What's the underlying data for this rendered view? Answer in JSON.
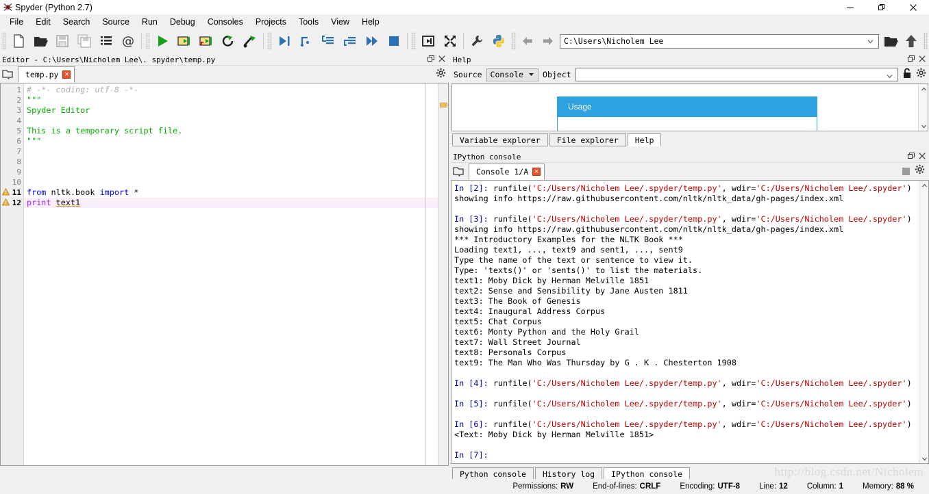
{
  "window": {
    "title": "Spyder (Python 2.7)",
    "logo_icon": "spyder-logo-icon",
    "minimize_label": "—",
    "restore_label": "❐",
    "close_label": "✕"
  },
  "menubar": {
    "items": [
      {
        "label": "File"
      },
      {
        "label": "Edit"
      },
      {
        "label": "Search"
      },
      {
        "label": "Source"
      },
      {
        "label": "Run"
      },
      {
        "label": "Debug"
      },
      {
        "label": "Consoles"
      },
      {
        "label": "Projects"
      },
      {
        "label": "Tools"
      },
      {
        "label": "View"
      },
      {
        "label": "Help"
      }
    ]
  },
  "toolbar": {
    "buttons": [
      {
        "name": "new-file-icon"
      },
      {
        "name": "open-file-icon"
      },
      {
        "name": "save-file-icon"
      },
      {
        "name": "save-all-icon"
      },
      {
        "name": "list-icon"
      },
      {
        "name": "at-sign-icon"
      },
      {
        "name": "run-icon"
      },
      {
        "name": "run-cell-icon"
      },
      {
        "name": "run-cell-advance-icon"
      },
      {
        "name": "rerun-icon"
      },
      {
        "name": "run-selection-icon"
      },
      {
        "name": "debug-icon"
      },
      {
        "name": "step-over-icon"
      },
      {
        "name": "step-into-icon"
      },
      {
        "name": "step-return-icon"
      },
      {
        "name": "continue-icon"
      },
      {
        "name": "stop-debug-icon"
      },
      {
        "name": "maximize-pane-icon"
      },
      {
        "name": "fullscreen-icon"
      },
      {
        "name": "preferences-icon"
      },
      {
        "name": "python-path-manager-icon"
      }
    ],
    "back_icon": "back-arrow-icon",
    "forward_icon": "forward-arrow-icon",
    "path_value": "C:\\Users\\Nicholem Lee",
    "browse_icon": "open-folder-icon",
    "parent_dir_icon": "up-arrow-icon"
  },
  "editor": {
    "panel_title": "Editor - C:\\Users\\Nicholem Lee\\. spyder\\temp.py",
    "undock_icon": "undock-icon",
    "close_icon": "close-icon",
    "browse_tabs_icon": "browse-tabs-icon",
    "options_icon": "gear-icon",
    "tab": {
      "label": "temp.py",
      "close_label": "×"
    },
    "lines": [
      {
        "n": "1",
        "warn": false,
        "tokens": [
          {
            "t": "# -*- coding: utf-8 -*-",
            "c": "c-com"
          }
        ]
      },
      {
        "n": "2",
        "warn": false,
        "tokens": [
          {
            "t": "\"\"\"",
            "c": "c-str"
          }
        ]
      },
      {
        "n": "3",
        "warn": false,
        "tokens": [
          {
            "t": "Spyder Editor",
            "c": "c-str"
          }
        ]
      },
      {
        "n": "4",
        "warn": false,
        "tokens": [
          {
            "t": "",
            "c": "c-str"
          }
        ]
      },
      {
        "n": "5",
        "warn": false,
        "tokens": [
          {
            "t": "This is a temporary script file.",
            "c": "c-str"
          }
        ]
      },
      {
        "n": "6",
        "warn": false,
        "tokens": [
          {
            "t": "\"\"\"",
            "c": "c-str"
          }
        ]
      },
      {
        "n": "7",
        "warn": false,
        "tokens": [
          {
            "t": "",
            "c": ""
          }
        ]
      },
      {
        "n": "8",
        "warn": false,
        "tokens": [
          {
            "t": "",
            "c": ""
          }
        ]
      },
      {
        "n": "9",
        "warn": false,
        "tokens": [
          {
            "t": "",
            "c": ""
          }
        ]
      },
      {
        "n": "10",
        "warn": false,
        "tokens": [
          {
            "t": "",
            "c": ""
          }
        ]
      },
      {
        "n": "11",
        "warn": true,
        "tokens": [
          {
            "t": "from",
            "c": "c-kw"
          },
          {
            "t": " nltk.book ",
            "c": ""
          },
          {
            "t": "import",
            "c": "c-kw"
          },
          {
            "t": " *",
            "c": ""
          }
        ]
      },
      {
        "n": "12",
        "warn": true,
        "current": true,
        "tokens": [
          {
            "t": "print",
            "c": "c-kw2"
          },
          {
            "t": " ",
            "c": ""
          },
          {
            "t": "text1",
            "c": "c-var"
          }
        ]
      }
    ],
    "warning_icon": "warning-triangle-icon",
    "scroll_marker": "warning-scroll-marker"
  },
  "help": {
    "panel_title": "Help",
    "undock_icon": "undock-icon",
    "close_icon": "close-icon",
    "source_label": "Source",
    "source_value": "Console",
    "object_label": "Object",
    "object_value": "",
    "object_placeholder": "",
    "lock_icon": "lock-icon",
    "options_icon": "gear-icon",
    "usage_card_title": "Usage",
    "usage_accent_color": "#2ea1e0",
    "scroll_up_icon": "chevron-up-icon",
    "scroll_down_icon": "chevron-down-icon",
    "tabs": [
      {
        "label": "Variable explorer",
        "active": false
      },
      {
        "label": "File explorer",
        "active": false
      },
      {
        "label": "Help",
        "active": true
      }
    ]
  },
  "console": {
    "panel_title": "IPython console",
    "undock_icon": "undock-icon",
    "close_icon": "close-icon",
    "browse_tabs_icon": "browse-tabs-icon",
    "stop_icon": "stop-icon",
    "options_icon": "gear-icon",
    "tab": {
      "label": "Console 1/A",
      "close_label": "×"
    },
    "scroll_up_icon": "chevron-up-icon",
    "scroll_down_icon": "chevron-down-icon",
    "output": [
      {
        "tokens": [
          {
            "t": "In [2]: ",
            "c": "o-in"
          },
          {
            "t": "runfile(",
            "c": ""
          },
          {
            "t": "'C:/Users/Nicholem Lee/.spyder/temp.py'",
            "c": "o-str"
          },
          {
            "t": ", wdir=",
            "c": ""
          },
          {
            "t": "'C:/Users/Nicholem Lee/.spyder'",
            "c": "o-str"
          },
          {
            "t": ")",
            "c": ""
          }
        ]
      },
      {
        "tokens": [
          {
            "t": "showing info https://raw.githubusercontent.com/nltk/nltk_data/gh-pages/index.xml",
            "c": ""
          }
        ]
      },
      {
        "tokens": [
          {
            "t": "",
            "c": ""
          }
        ]
      },
      {
        "tokens": [
          {
            "t": "In [3]: ",
            "c": "o-in"
          },
          {
            "t": "runfile(",
            "c": ""
          },
          {
            "t": "'C:/Users/Nicholem Lee/.spyder/temp.py'",
            "c": "o-str"
          },
          {
            "t": ", wdir=",
            "c": ""
          },
          {
            "t": "'C:/Users/Nicholem Lee/.spyder'",
            "c": "o-str"
          },
          {
            "t": ")",
            "c": ""
          }
        ]
      },
      {
        "tokens": [
          {
            "t": "showing info https://raw.githubusercontent.com/nltk/nltk_data/gh-pages/index.xml",
            "c": ""
          }
        ]
      },
      {
        "tokens": [
          {
            "t": "*** Introductory Examples for the NLTK Book ***",
            "c": ""
          }
        ]
      },
      {
        "tokens": [
          {
            "t": "Loading text1, ..., text9 and sent1, ..., sent9",
            "c": ""
          }
        ]
      },
      {
        "tokens": [
          {
            "t": "Type the name of the text or sentence to view it.",
            "c": ""
          }
        ]
      },
      {
        "tokens": [
          {
            "t": "Type: 'texts()' or 'sents()' to list the materials.",
            "c": ""
          }
        ]
      },
      {
        "tokens": [
          {
            "t": "text1: Moby Dick by Herman Melville 1851",
            "c": ""
          }
        ]
      },
      {
        "tokens": [
          {
            "t": "text2: Sense and Sensibility by Jane Austen 1811",
            "c": ""
          }
        ]
      },
      {
        "tokens": [
          {
            "t": "text3: The Book of Genesis",
            "c": ""
          }
        ]
      },
      {
        "tokens": [
          {
            "t": "text4: Inaugural Address Corpus",
            "c": ""
          }
        ]
      },
      {
        "tokens": [
          {
            "t": "text5: Chat Corpus",
            "c": ""
          }
        ]
      },
      {
        "tokens": [
          {
            "t": "text6: Monty Python and the Holy Grail",
            "c": ""
          }
        ]
      },
      {
        "tokens": [
          {
            "t": "text7: Wall Street Journal",
            "c": ""
          }
        ]
      },
      {
        "tokens": [
          {
            "t": "text8: Personals Corpus",
            "c": ""
          }
        ]
      },
      {
        "tokens": [
          {
            "t": "text9: The Man Who Was Thursday by G . K . Chesterton 1908",
            "c": ""
          }
        ]
      },
      {
        "tokens": [
          {
            "t": "",
            "c": ""
          }
        ]
      },
      {
        "tokens": [
          {
            "t": "In [4]: ",
            "c": "o-in"
          },
          {
            "t": "runfile(",
            "c": ""
          },
          {
            "t": "'C:/Users/Nicholem Lee/.spyder/temp.py'",
            "c": "o-str"
          },
          {
            "t": ", wdir=",
            "c": ""
          },
          {
            "t": "'C:/Users/Nicholem Lee/.spyder'",
            "c": "o-str"
          },
          {
            "t": ")",
            "c": ""
          }
        ]
      },
      {
        "tokens": [
          {
            "t": "",
            "c": ""
          }
        ]
      },
      {
        "tokens": [
          {
            "t": "In [5]: ",
            "c": "o-in"
          },
          {
            "t": "runfile(",
            "c": ""
          },
          {
            "t": "'C:/Users/Nicholem Lee/.spyder/temp.py'",
            "c": "o-str"
          },
          {
            "t": ", wdir=",
            "c": ""
          },
          {
            "t": "'C:/Users/Nicholem Lee/.spyder'",
            "c": "o-str"
          },
          {
            "t": ")",
            "c": ""
          }
        ]
      },
      {
        "tokens": [
          {
            "t": "",
            "c": ""
          }
        ]
      },
      {
        "tokens": [
          {
            "t": "In [6]: ",
            "c": "o-in"
          },
          {
            "t": "runfile(",
            "c": ""
          },
          {
            "t": "'C:/Users/Nicholem Lee/.spyder/temp.py'",
            "c": "o-str"
          },
          {
            "t": ", wdir=",
            "c": ""
          },
          {
            "t": "'C:/Users/Nicholem Lee/.spyder'",
            "c": "o-str"
          },
          {
            "t": ")",
            "c": ""
          }
        ]
      },
      {
        "tokens": [
          {
            "t": "<Text: Moby Dick by Herman Melville 1851>",
            "c": ""
          }
        ]
      },
      {
        "tokens": [
          {
            "t": "",
            "c": ""
          }
        ]
      },
      {
        "tokens": [
          {
            "t": "In [7]: ",
            "c": "o-in"
          }
        ]
      }
    ],
    "tabs": [
      {
        "label": "Python console",
        "active": false
      },
      {
        "label": "History log",
        "active": false
      },
      {
        "label": "IPython console",
        "active": true
      }
    ]
  },
  "statusbar": {
    "items": [
      {
        "label": "Permissions:",
        "value": "RW"
      },
      {
        "label": "End-of-lines:",
        "value": "CRLF"
      },
      {
        "label": "Encoding:",
        "value": "UTF-8"
      },
      {
        "label": "Line:",
        "value": "12"
      },
      {
        "label": "Column:",
        "value": "1"
      },
      {
        "label": "Memory:",
        "value": "88 %"
      }
    ]
  },
  "watermark": {
    "text": "http://blog.csdn.net/Nicholem"
  }
}
